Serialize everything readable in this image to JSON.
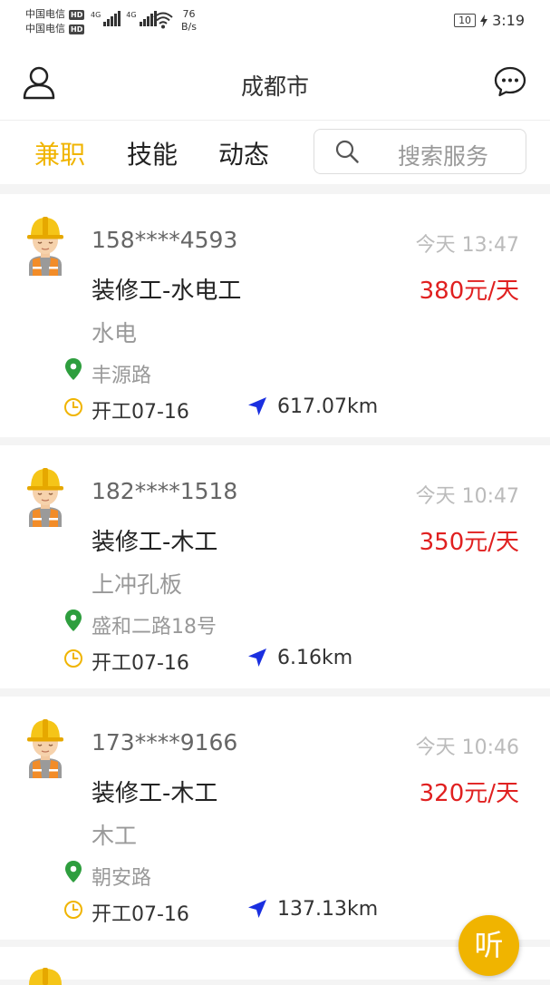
{
  "status_bar": {
    "carrier_1": "中国电信",
    "carrier_2": "中国电信",
    "hd_badge": "HD",
    "network_1": "4G",
    "network_2": "4G",
    "speed_value": "76",
    "speed_unit": "B/s",
    "battery": "10",
    "clock": "3:19"
  },
  "header": {
    "city": "成都市",
    "left_icon": "user-icon",
    "right_icon": "message-icon"
  },
  "tabs": [
    {
      "label": "兼职",
      "active": true
    },
    {
      "label": "技能",
      "active": false
    },
    {
      "label": "动态",
      "active": false
    }
  ],
  "search": {
    "placeholder": "搜索服务"
  },
  "jobs": [
    {
      "phone": "158****4593",
      "time": "今天 13:47",
      "title": "装修工-水电工",
      "price": "380元/天",
      "desc": "水电",
      "location": "丰源路",
      "start": "开工07-16",
      "distance": "617.07km"
    },
    {
      "phone": "182****1518",
      "time": "今天 10:47",
      "title": "装修工-木工",
      "price": "350元/天",
      "desc": "上冲孔板",
      "location": "盛和二路18号",
      "start": "开工07-16",
      "distance": "6.16km"
    },
    {
      "phone": "173****9166",
      "time": "今天 10:46",
      "title": "装修工-木工",
      "price": "320元/天",
      "desc": "木工",
      "location": "朝安路",
      "start": "开工07-16",
      "distance": "137.13km"
    }
  ],
  "fab": {
    "label": "听"
  },
  "colors": {
    "accent": "#f0b400",
    "price": "#e02020",
    "location": "#2e9e3e",
    "nav": "#1a2fe0"
  }
}
